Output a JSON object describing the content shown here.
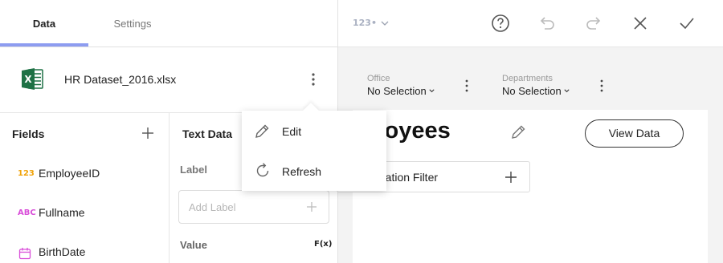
{
  "tabs": [
    {
      "label": "Data",
      "active": true
    },
    {
      "label": "Settings",
      "active": false
    }
  ],
  "dataset": {
    "name": "HR Dataset_2016.xlsx",
    "icon": "excel-icon",
    "excel_letter": "X"
  },
  "fields": {
    "title": "Fields",
    "items": [
      {
        "type_badge": "123",
        "type": "number",
        "label": "EmployeeID"
      },
      {
        "type_badge": "ABC",
        "type": "string",
        "label": "Fullname"
      },
      {
        "type_badge": "",
        "type": "date",
        "label": "BirthDate"
      }
    ]
  },
  "text_data": {
    "title": "Text Data",
    "label_heading": "Label",
    "label_placeholder": "Add Label",
    "value_heading": "Value",
    "fx_label": "F(x)"
  },
  "toolbar": {
    "viz_type_badge": "123•",
    "icons": [
      "help-icon",
      "undo-icon",
      "redo-icon",
      "close-icon",
      "check-icon"
    ]
  },
  "dashboard_filters": [
    {
      "name": "Office",
      "value": "No Selection"
    },
    {
      "name": "Departments",
      "value": "No Selection"
    }
  ],
  "visualization": {
    "title": "mployees",
    "view_data_label": "View Data",
    "filter_button_label": "d Visualization Filter"
  },
  "context_menu": {
    "items": [
      {
        "label": "Edit",
        "icon": "pencil-icon"
      },
      {
        "label": "Refresh",
        "icon": "refresh-icon"
      }
    ]
  },
  "colors": {
    "accent_underline": "#8d9cf0",
    "number_badge": "#f0a30a",
    "string_badge": "#d94fd9",
    "date_badge": "#d94fd9",
    "excel_green": "#1e7145",
    "canvas_bg": "#f3f3f3"
  }
}
